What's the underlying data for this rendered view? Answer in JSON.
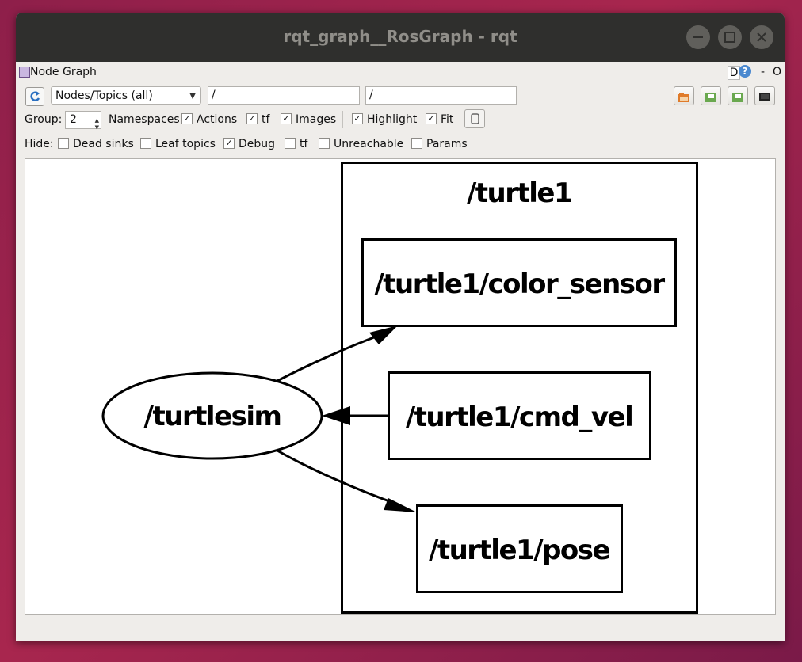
{
  "window": {
    "title": "rqt_graph__RosGraph - rqt",
    "minimize_icon": "minimize-icon",
    "maximize_icon": "maximize-icon",
    "close_icon": "close-icon"
  },
  "panel": {
    "title": "Node Graph",
    "d_label": "D",
    "help_label": "?",
    "dash_label": "-",
    "o_label": "O"
  },
  "toolbar": {
    "graph_type": "Nodes/Topics (all)",
    "node_filter": "/",
    "topic_filter": "/"
  },
  "options": {
    "group_label": "Group:",
    "group_value": "2",
    "namespaces_label": "Namespaces",
    "namespaces_checked": true,
    "actions_label": "Actions",
    "actions_checked": true,
    "tf_label": "tf",
    "tf_checked": true,
    "images_label": "Images",
    "images_checked": true,
    "highlight_label": "Highlight",
    "highlight_checked": true,
    "fit_label": "Fit",
    "fit_checked": true
  },
  "hide": {
    "hide_label": "Hide:",
    "dead_sinks_label": "Dead sinks",
    "dead_sinks_checked": false,
    "leaf_topics_label": "Leaf topics",
    "leaf_topics_checked": false,
    "debug_label": "Debug",
    "debug_checked": true,
    "tf_label": "tf",
    "tf_checked": false,
    "unreachable_label": "Unreachable",
    "unreachable_checked": false,
    "params_label": "Params",
    "params_checked": false
  },
  "graph": {
    "cluster_label": "/turtle1",
    "node_label": "/turtlesim",
    "topic_color_sensor": "/turtle1/color_sensor",
    "topic_cmd_vel": "/turtle1/cmd_vel",
    "topic_pose": "/turtle1/pose"
  }
}
